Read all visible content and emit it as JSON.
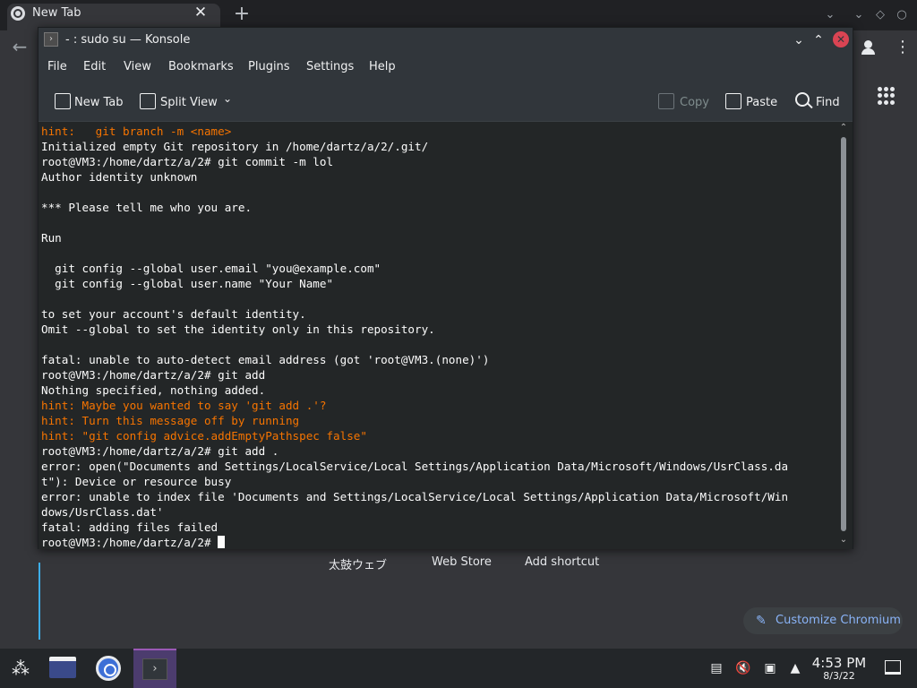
{
  "browser": {
    "tab_title": "New Tab",
    "shortcuts": [
      "太鼓ウェブ",
      "Web Store",
      "Add shortcut"
    ],
    "customize_label": "Customize Chromium"
  },
  "konsole": {
    "title": "- : sudo su — Konsole",
    "menu": [
      "File",
      "Edit",
      "View",
      "Bookmarks",
      "Plugins",
      "Settings",
      "Help"
    ],
    "toolbar": {
      "new_tab": "New Tab",
      "split_view": "Split View",
      "copy": "Copy",
      "paste": "Paste",
      "find": "Find"
    },
    "terminal_lines": [
      {
        "text": "hint:   git branch -m <name>",
        "hint": true
      },
      {
        "text": "Initialized empty Git repository in /home/dartz/a/2/.git/",
        "hint": false
      },
      {
        "text": "root@VM3:/home/dartz/a/2# git commit -m lol",
        "hint": false
      },
      {
        "text": "Author identity unknown",
        "hint": false
      },
      {
        "text": "",
        "hint": false
      },
      {
        "text": "*** Please tell me who you are.",
        "hint": false
      },
      {
        "text": "",
        "hint": false
      },
      {
        "text": "Run",
        "hint": false
      },
      {
        "text": "",
        "hint": false
      },
      {
        "text": "  git config --global user.email \"you@example.com\"",
        "hint": false
      },
      {
        "text": "  git config --global user.name \"Your Name\"",
        "hint": false
      },
      {
        "text": "",
        "hint": false
      },
      {
        "text": "to set your account's default identity.",
        "hint": false
      },
      {
        "text": "Omit --global to set the identity only in this repository.",
        "hint": false
      },
      {
        "text": "",
        "hint": false
      },
      {
        "text": "fatal: unable to auto-detect email address (got 'root@VM3.(none)')",
        "hint": false
      },
      {
        "text": "root@VM3:/home/dartz/a/2# git add",
        "hint": false
      },
      {
        "text": "Nothing specified, nothing added.",
        "hint": false
      },
      {
        "text": "hint: Maybe you wanted to say 'git add .'?",
        "hint": true
      },
      {
        "text": "hint: Turn this message off by running",
        "hint": true
      },
      {
        "text": "hint: \"git config advice.addEmptyPathspec false\"",
        "hint": true
      },
      {
        "text": "root@VM3:/home/dartz/a/2# git add .",
        "hint": false
      },
      {
        "text": "error: open(\"Documents and Settings/LocalService/Local Settings/Application Data/Microsoft/Windows/UsrClass.da",
        "hint": false
      },
      {
        "text": "t\"): Device or resource busy",
        "hint": false
      },
      {
        "text": "error: unable to index file 'Documents and Settings/LocalService/Local Settings/Application Data/Microsoft/Win",
        "hint": false
      },
      {
        "text": "dows/UsrClass.dat'",
        "hint": false
      },
      {
        "text": "fatal: adding files failed",
        "hint": false
      }
    ],
    "prompt": "root@VM3:/home/dartz/a/2# "
  },
  "taskbar": {
    "time": "4:53 PM",
    "date": "8/3/22"
  }
}
